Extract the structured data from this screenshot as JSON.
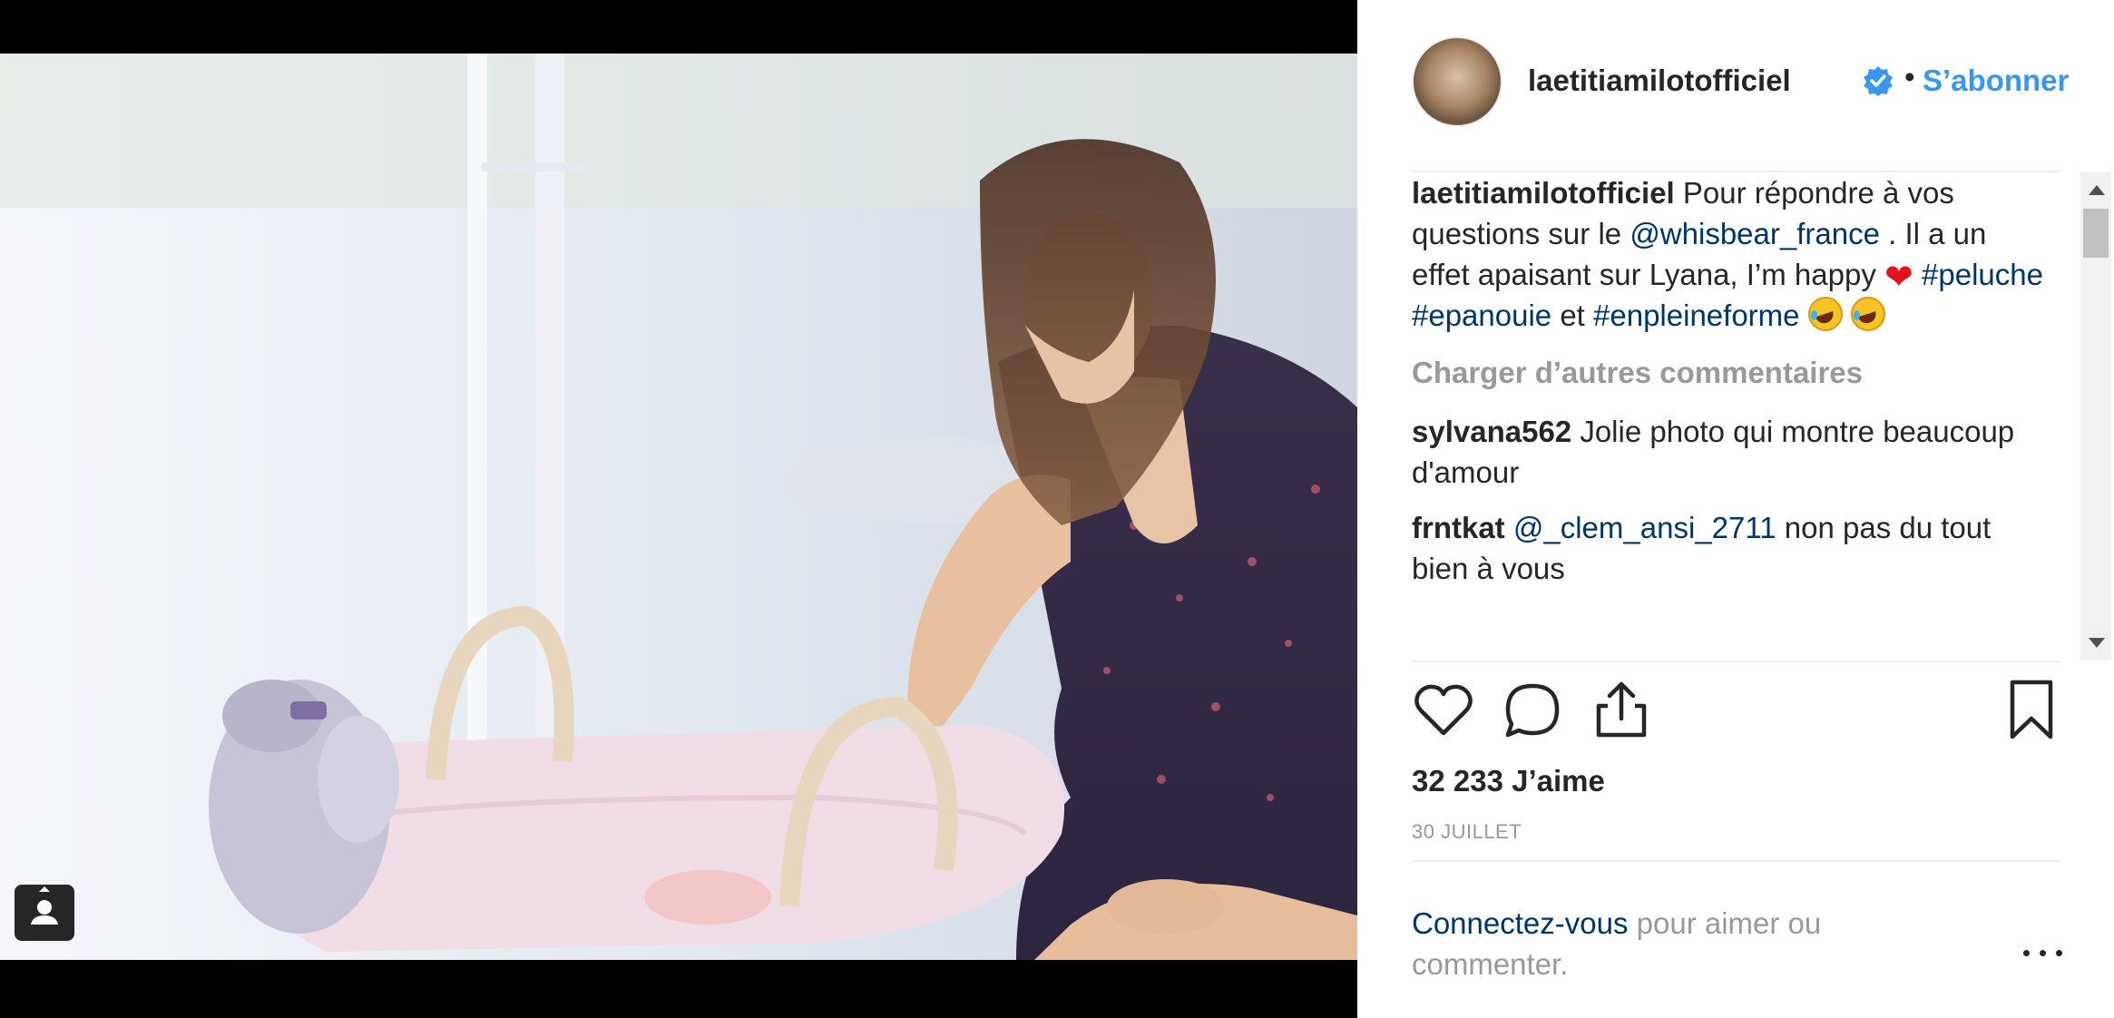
{
  "post": {
    "author": "laetitiamilotofficiel",
    "separator": "•",
    "follow_label": "S’abonner",
    "caption": {
      "username": "laetitiamilotofficiel",
      "text_1": " Pour répondre à vos questions sur le ",
      "mention": "@whisbear_france",
      "text_2": " . Il a un effet apaisant sur Lyana, I’m happy ",
      "hashtag_1": "#peluche",
      "hashtag_2": "#epanouie",
      "conjunction": " et ",
      "hashtag_3": "#enpleineforme"
    },
    "load_more_label": "Charger d’autres commentaires",
    "comments": [
      {
        "username": "sylvana562",
        "text": " Jolie photo qui montre beaucoup d'amour"
      },
      {
        "username": "frntkat",
        "mention": "@_clem_ansi_2711",
        "text": " non pas du tout bien à vous"
      }
    ],
    "likes": "32 233 J’aime",
    "date": "30 JUILLET",
    "login_link": "Connectez-vous",
    "login_text": " pour aimer ou commenter."
  },
  "icons": {
    "verified": "verified-badge-icon",
    "like": "heart-icon",
    "comment": "comment-bubble-icon",
    "share": "share-icon",
    "save": "bookmark-icon",
    "more": "more-options-icon",
    "tag": "user-tag-icon"
  },
  "colors": {
    "link_blue": "#3897f0",
    "mention_blue": "#003569",
    "text": "#262626",
    "muted": "#999999",
    "heart_red": "#e0151a"
  }
}
